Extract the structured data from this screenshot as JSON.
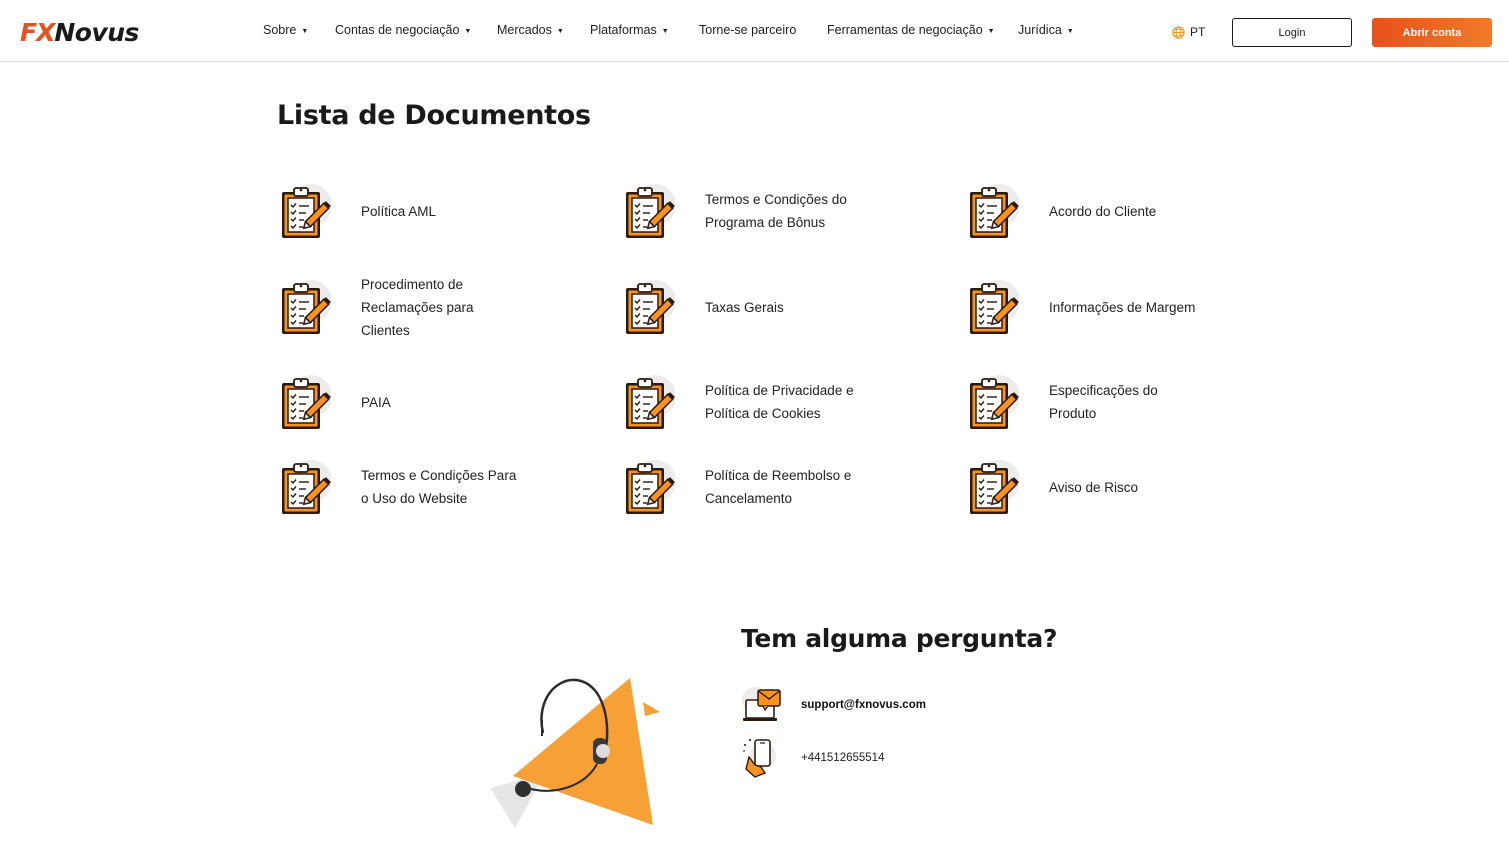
{
  "header": {
    "logo": {
      "part1": "FX",
      "part2": "Novus"
    },
    "nav": [
      {
        "label": "Sobre",
        "has_dropdown": true
      },
      {
        "label": "Contas de negociação",
        "has_dropdown": true
      },
      {
        "label": "Mercados",
        "has_dropdown": true
      },
      {
        "label": "Plataformas",
        "has_dropdown": true
      },
      {
        "label": "Torne-se parceiro",
        "has_dropdown": false
      },
      {
        "label": "Ferramentas de negociação",
        "has_dropdown": true
      },
      {
        "label": "Jurídica",
        "has_dropdown": true
      }
    ],
    "language": "PT",
    "login_label": "Login",
    "open_account_label": "Abrir conta"
  },
  "documents": {
    "title": "Lista de Documentos",
    "items": [
      {
        "label": "Política AML"
      },
      {
        "label": "Termos e Condições do Programa de Bônus"
      },
      {
        "label": "Acordo do Cliente"
      },
      {
        "label": "Procedimento de Reclamações para Clientes"
      },
      {
        "label": "Taxas Gerais"
      },
      {
        "label": "Informações de Margem"
      },
      {
        "label": "PAIA"
      },
      {
        "label": "Política de Privacidade e Política de Cookies"
      },
      {
        "label": "Especificações do Produto"
      },
      {
        "label": "Termos e Condições Para o Uso do Website"
      },
      {
        "label": "Política de Reembolso e Cancelamento"
      },
      {
        "label": "Aviso de Risco"
      }
    ]
  },
  "contact": {
    "title": "Tem alguma pergunta?",
    "email": "support@fxnovus.com",
    "phone": "+441512655514"
  },
  "colors": {
    "brand_orange": "#e8501e",
    "accent_orange": "#f7931e",
    "text_dark": "#1a1a1a"
  },
  "icons": {
    "document": "clipboard-checklist-icon",
    "email": "email-laptop-icon",
    "phone": "phone-hand-icon",
    "language": "globe-icon"
  }
}
